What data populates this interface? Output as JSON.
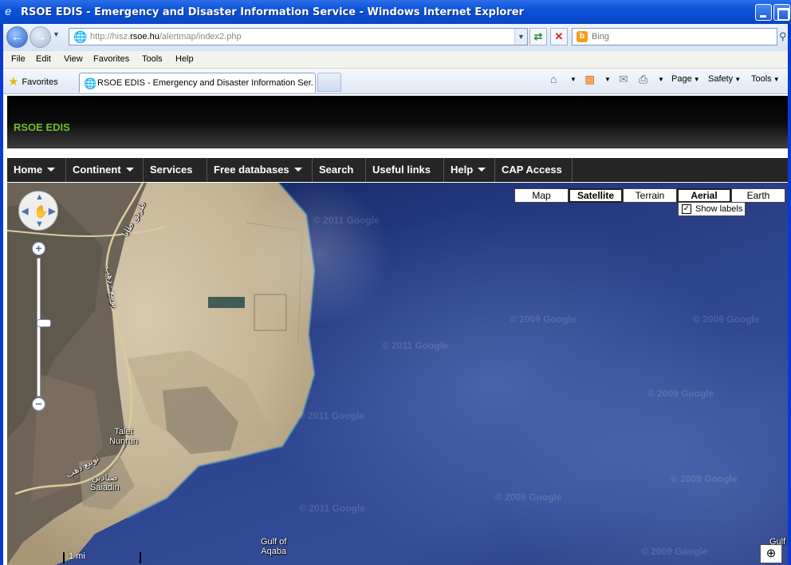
{
  "window": {
    "title": "RSOE EDIS - Emergency and Disaster Information Service - Windows Internet Explorer"
  },
  "address_bar": {
    "url_prefix": "http://hisz.",
    "url_domain": "rsoe.hu",
    "url_path": "/alertmap/index2.php"
  },
  "search": {
    "placeholder": "Bing"
  },
  "menu": [
    "File",
    "Edit",
    "View",
    "Favorites",
    "Tools",
    "Help"
  ],
  "favorites_label": "Favorites",
  "tab": {
    "label": "RSOE EDIS - Emergency and Disaster Information Ser..."
  },
  "command_bar": {
    "page": "Page",
    "safety": "Safety",
    "tools": "Tools"
  },
  "site": {
    "brand": "RSOE EDIS",
    "nav": [
      {
        "label": "Home",
        "dropdown": true
      },
      {
        "label": "Continent",
        "dropdown": true
      },
      {
        "label": "Services",
        "dropdown": false
      },
      {
        "label": "Free databases",
        "dropdown": true
      },
      {
        "label": "Search",
        "dropdown": false
      },
      {
        "label": "Useful links",
        "dropdown": false
      },
      {
        "label": "Help",
        "dropdown": true
      },
      {
        "label": "CAP Access",
        "dropdown": false
      }
    ]
  },
  "map": {
    "types": [
      "Map",
      "Satellite",
      "Terrain",
      "Aerial",
      "Earth"
    ],
    "selected_types": [
      "Satellite",
      "Aerial"
    ],
    "show_labels": {
      "label": "Show labels",
      "checked": true
    },
    "place_labels": {
      "talet_nunrun": "Talet\nNunrun",
      "saiadin": "صيادين\nSaiadin",
      "gulf_aqaba": "Gulf of\nAqaba",
      "gulf_right": "Gulf of",
      "road_ar_1": "طريق طابا",
      "road_ar_2": "نويبع - دهب",
      "road_ar_3": "نويبع دهب"
    },
    "watermarks": [
      "© 2009 Google",
      "© 2011 Google",
      "© 2011 Google"
    ],
    "scale_label": "1 mi",
    "colors": {
      "sea": "#2a3f86",
      "land": "#c8b79a",
      "brand_green": "#6fbe2e"
    }
  }
}
